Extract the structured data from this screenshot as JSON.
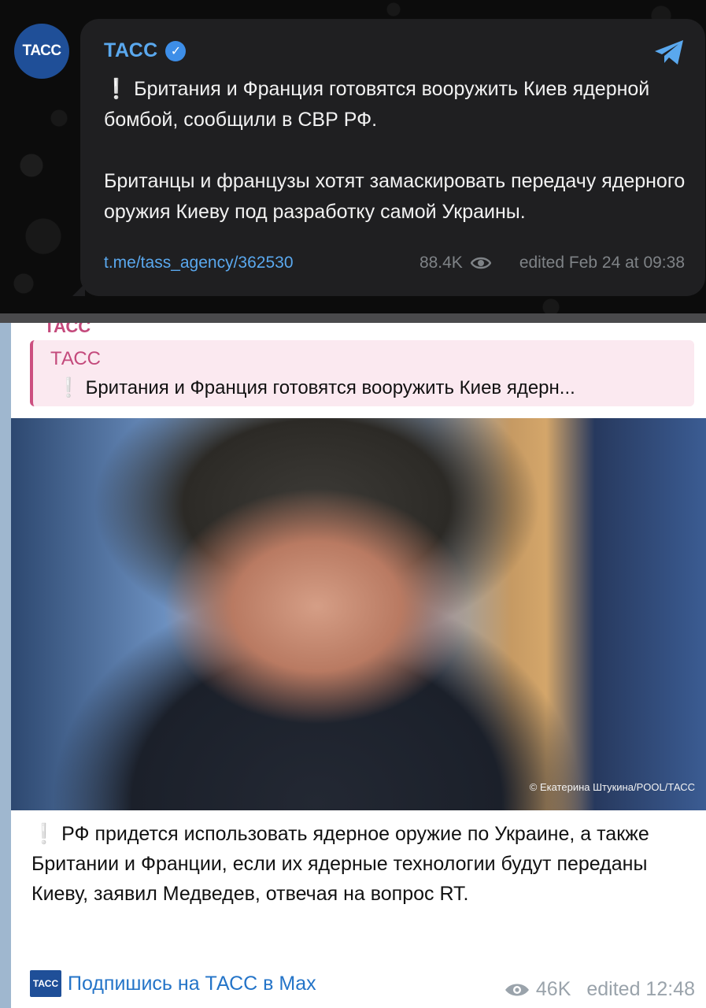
{
  "top_post": {
    "avatar_text": "ТАСС",
    "channel_name": "ТАСС",
    "verified_mark": "✓",
    "excl_mark": "❕",
    "text_line1": "Британия и Франция готовятся вооружить Киев ядерной бомбой, сообщили в СВР РФ.",
    "text_line2": "Британцы и французы хотят замаскировать передачу ядерного оружия Киеву под разработку самой Украины.",
    "link": "t.me/tass_agency/362530",
    "views": "88.4K",
    "edited": "edited  Feb 24 at 09:38",
    "icons": {
      "verified": "verified-badge-icon",
      "share": "telegram-share-icon",
      "views": "eye-icon"
    }
  },
  "bottom_post": {
    "cut_channel": "ТАСС",
    "quote": {
      "channel": "ТАСС",
      "excl_mark": "❕",
      "text": "Британия и Франция готовятся вооружить Киев ядерн..."
    },
    "photo_credit": "© Екатерина Штукина/POOL/ТАСС",
    "excl_mark": "❕",
    "text": "РФ придется использовать ядерное оружие по Украине, а также Британии и Франции, если их ядерные технологии будут переданы Киеву, заявил Медведев, отвечая на вопрос RT.",
    "promo_icon_text": "ТАСС",
    "promo_link": "Подпишись на ТАСС в Max",
    "views": "46K",
    "edited": "edited 12:48"
  },
  "colors": {
    "dark_bubble": "#1f1f21",
    "dark_link": "#5aa8ee",
    "tass_blue": "#1f4f98",
    "quote_accent": "#cc4f80",
    "light_link": "#2474c8"
  }
}
